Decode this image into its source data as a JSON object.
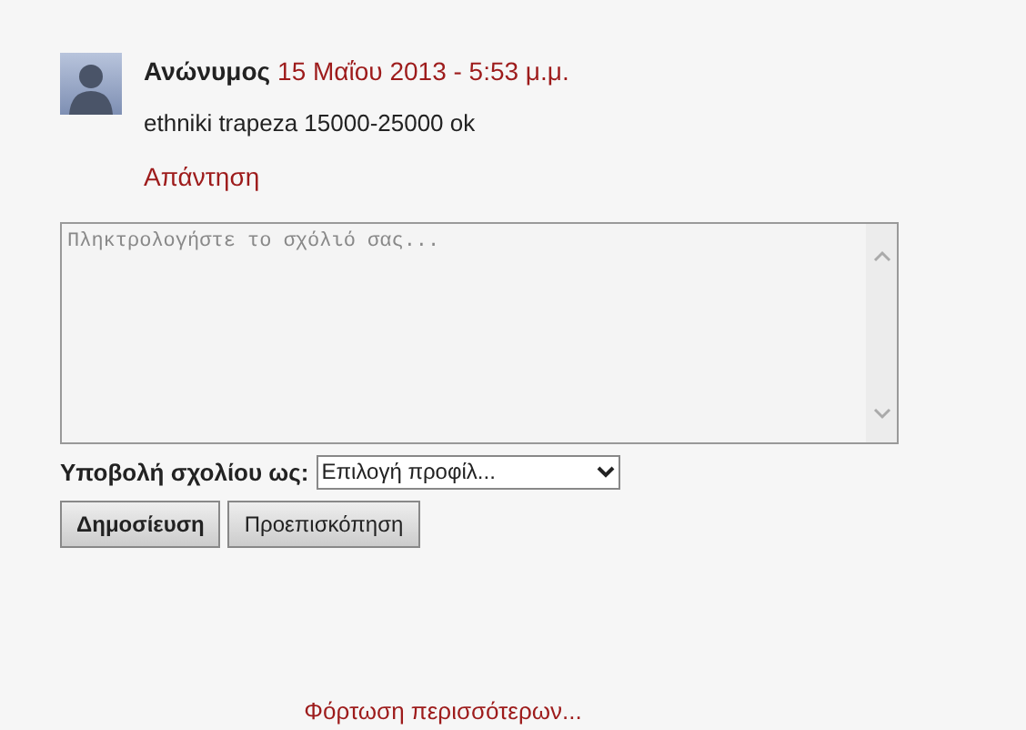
{
  "comment": {
    "author": "Ανώνυμος",
    "date": "15 Μαΐου 2013 - 5:53 μ.μ.",
    "text": "ethniki trapeza 15000-25000 ok",
    "reply": "Απάντηση"
  },
  "form": {
    "placeholder": "Πληκτρολογήστε το σχόλιό σας...",
    "profile_label": "Υποβολή σχολίου ως:",
    "profile_value": "Επιλογή προφίλ...",
    "buttons": [
      {
        "label": "Δημοσίευση",
        "kind": "submit"
      },
      {
        "label": "Προεπισκόπηση",
        "kind": "preview"
      }
    ]
  },
  "load_more": "Φόρτωση περισσότερων..."
}
